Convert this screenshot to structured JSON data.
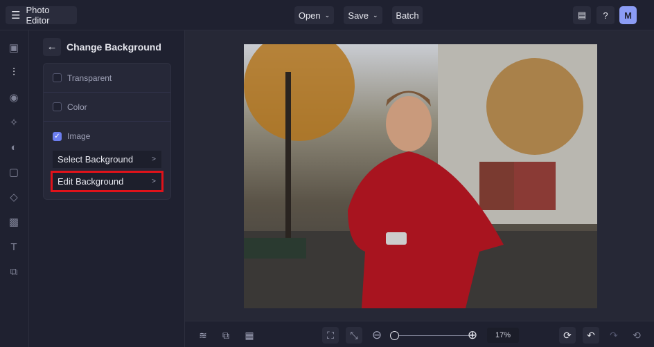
{
  "header": {
    "title": "Photo Editor",
    "open": "Open",
    "save": "Save",
    "batch": "Batch",
    "avatar": "M"
  },
  "panel": {
    "title": "Change Background",
    "options": [
      {
        "label": "Transparent",
        "checked": false
      },
      {
        "label": "Color",
        "checked": false
      },
      {
        "label": "Image",
        "checked": true
      }
    ],
    "select_background": "Select Background",
    "edit_background": "Edit Background"
  },
  "zoom": {
    "level": "17%",
    "slider_fraction": 0.0
  },
  "colors": {
    "accent": "#6c7ef0",
    "highlight": "#e0121a"
  }
}
